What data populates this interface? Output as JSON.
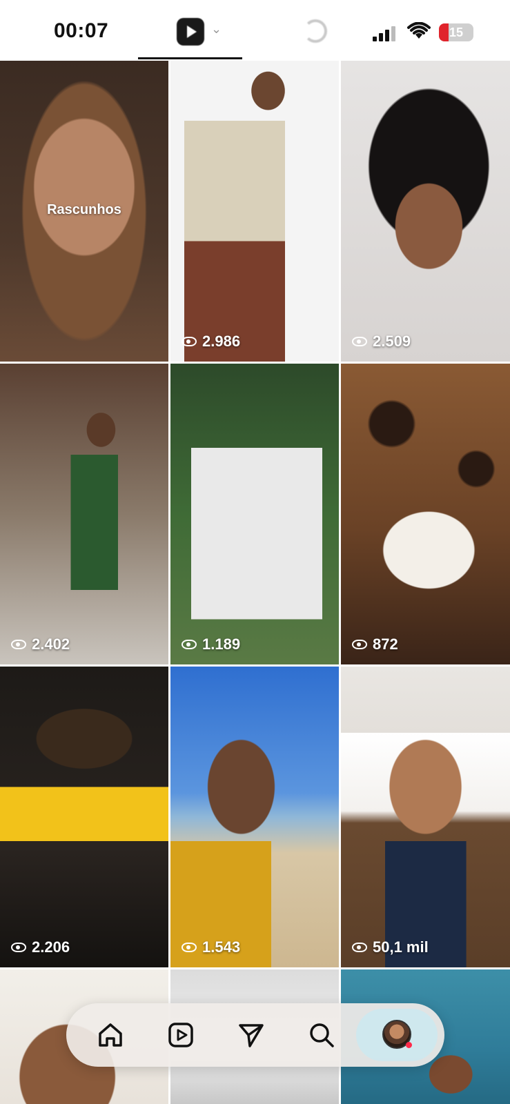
{
  "status_bar": {
    "time": "00:07",
    "battery": "15"
  },
  "grid": {
    "tiles": [
      {
        "views": "",
        "label": "Rascunhos"
      },
      {
        "views": "2.986"
      },
      {
        "views": "2.509"
      },
      {
        "views": "2.402"
      },
      {
        "views": "1.189"
      },
      {
        "views": "872"
      },
      {
        "views": "2.206"
      },
      {
        "views": "1.543"
      },
      {
        "views": "50,1 mil"
      }
    ]
  },
  "bottom_nav": {
    "items": [
      "home-icon",
      "reels-icon",
      "direct-send-icon",
      "search-icon",
      "profile-avatar"
    ]
  },
  "colors": {
    "accent_notification": "#ff2a4a",
    "battery_low": "#e0242c"
  }
}
